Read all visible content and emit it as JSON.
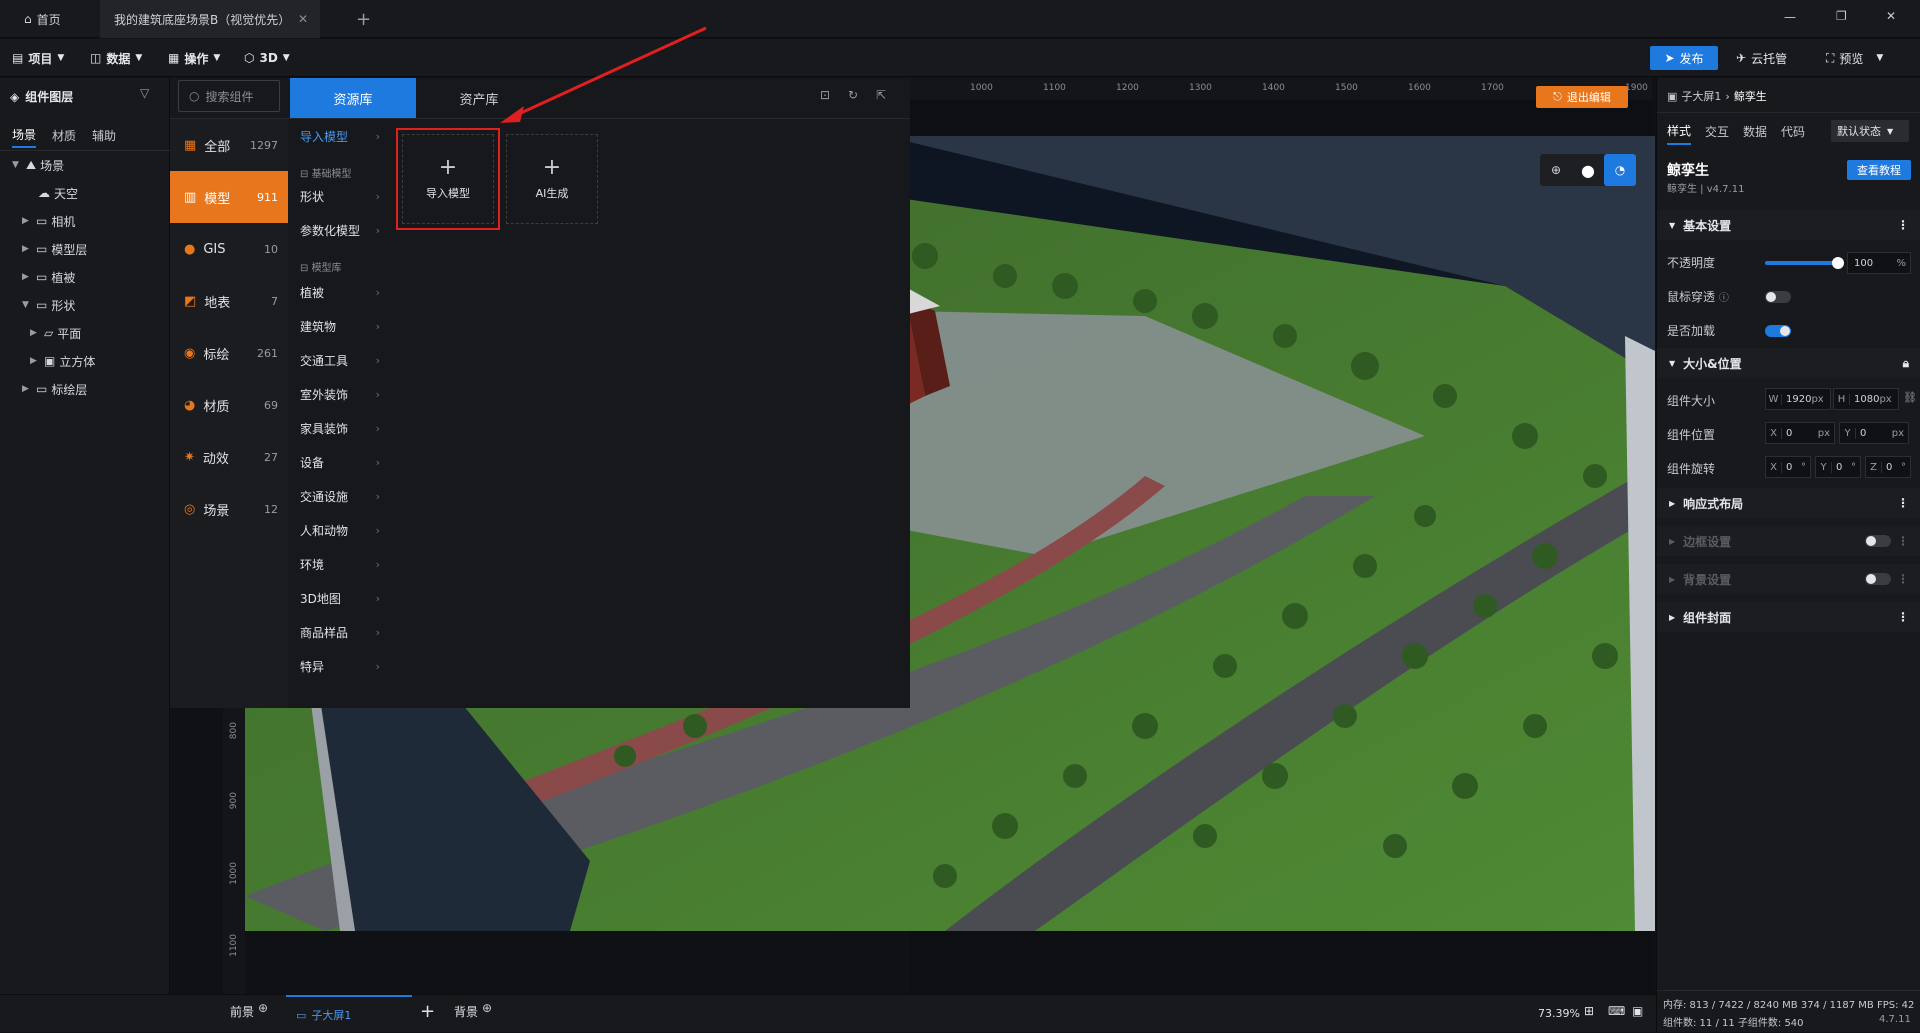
{
  "titlebar": {
    "home_tab": "首页",
    "doc_tab": "我的建筑底座场景B（视觉优先）",
    "new_tab": "+",
    "min": "—",
    "restore": "❐",
    "close": "✕"
  },
  "toolbar": {
    "project": "项目",
    "data": "数据",
    "ops": "操作",
    "mode": "3D",
    "publish": "发布",
    "cloud": "云托管",
    "preview": "预览"
  },
  "layers": {
    "title": "组件图层",
    "tabs": [
      "场景",
      "材质",
      "辅助"
    ],
    "tree": [
      {
        "label": "场景",
        "level": 0
      },
      {
        "label": "天空",
        "level": 1
      },
      {
        "label": "相机",
        "level": 1
      },
      {
        "label": "模型层",
        "level": 1
      },
      {
        "label": "植被",
        "level": 1
      },
      {
        "label": "形状",
        "level": 1
      },
      {
        "label": "平面",
        "level": 2
      },
      {
        "label": "立方体",
        "level": 2
      },
      {
        "label": "标绘层",
        "level": 1
      }
    ]
  },
  "resource": {
    "search_placeholder": "搜索组件",
    "tab_resource": "资源库",
    "tab_asset": "资产库",
    "categories": [
      {
        "label": "全部",
        "count": "1297"
      },
      {
        "label": "模型",
        "count": "911"
      },
      {
        "label": "GIS",
        "count": "10"
      },
      {
        "label": "地表",
        "count": "7"
      },
      {
        "label": "标绘",
        "count": "261"
      },
      {
        "label": "材质",
        "count": "69"
      },
      {
        "label": "动效",
        "count": "27"
      },
      {
        "label": "场景",
        "count": "12"
      }
    ],
    "import_model": "导入模型",
    "head_basic": "基础模型",
    "basic": [
      "形状",
      "参数化模型"
    ],
    "head_lib": "模型库",
    "lib": [
      "植被",
      "建筑物",
      "交通工具",
      "室外装饰",
      "家具装饰",
      "设备",
      "交通设施",
      "人和动物",
      "环境",
      "3D地图",
      "商品样品",
      "特异"
    ],
    "card_import": "导入模型",
    "card_ai": "AI生成"
  },
  "viewport": {
    "exit_edit": "退出编辑",
    "ruler_top": [
      "1000",
      "1100",
      "1200",
      "1300",
      "1400",
      "1500",
      "1600",
      "1700",
      "1900"
    ],
    "ruler_left": [
      "800",
      "900",
      "1000",
      "1100"
    ]
  },
  "right": {
    "breadcrumb_parent": "子大屏1",
    "breadcrumb_current": "鲸孪生",
    "tabs": [
      "样式",
      "交互",
      "数据",
      "代码"
    ],
    "state": "默认状态",
    "comp_name": "鲸孪生",
    "comp_version": "鲸孪生 | v4.7.11",
    "tutorial": "查看教程",
    "sec_basic": "基本设置",
    "opacity_label": "不透明度",
    "opacity_value": "100",
    "opacity_unit": "%",
    "mouse_label": "鼠标穿透",
    "preload_label": "是否加载",
    "sec_size": "大小&位置",
    "size_label": "组件大小",
    "w_label": "W",
    "w_value": "1920",
    "h_label": "H",
    "h_value": "1080",
    "px": "px",
    "pos_label": "组件位置",
    "x_label": "X",
    "x_value": "0",
    "y_label": "Y",
    "y_value": "0",
    "rot_label": "组件旋转",
    "rx": "0",
    "ry": "0",
    "rz": "0",
    "z_label": "Z",
    "deg": "°",
    "sec_responsive": "响应式布局",
    "sec_border": "边框设置",
    "sec_bg": "背景设置",
    "sec_cover": "组件封面",
    "status_mem": "内存: 813 / 7422 / 8240 MB  374 / 1187 MB  FPS: 42",
    "status_count": "组件数: 11 / 11   子组件数: 540",
    "status_version": "4.7.11"
  },
  "bottom": {
    "front": "前景",
    "screen": "子大屏1",
    "add": "+",
    "back": "背景",
    "zoom": "73.39%"
  },
  "colors": {
    "accent_orange": "#e8761c",
    "accent_blue": "#1f7ae0",
    "highlight_red": "#e02020"
  }
}
